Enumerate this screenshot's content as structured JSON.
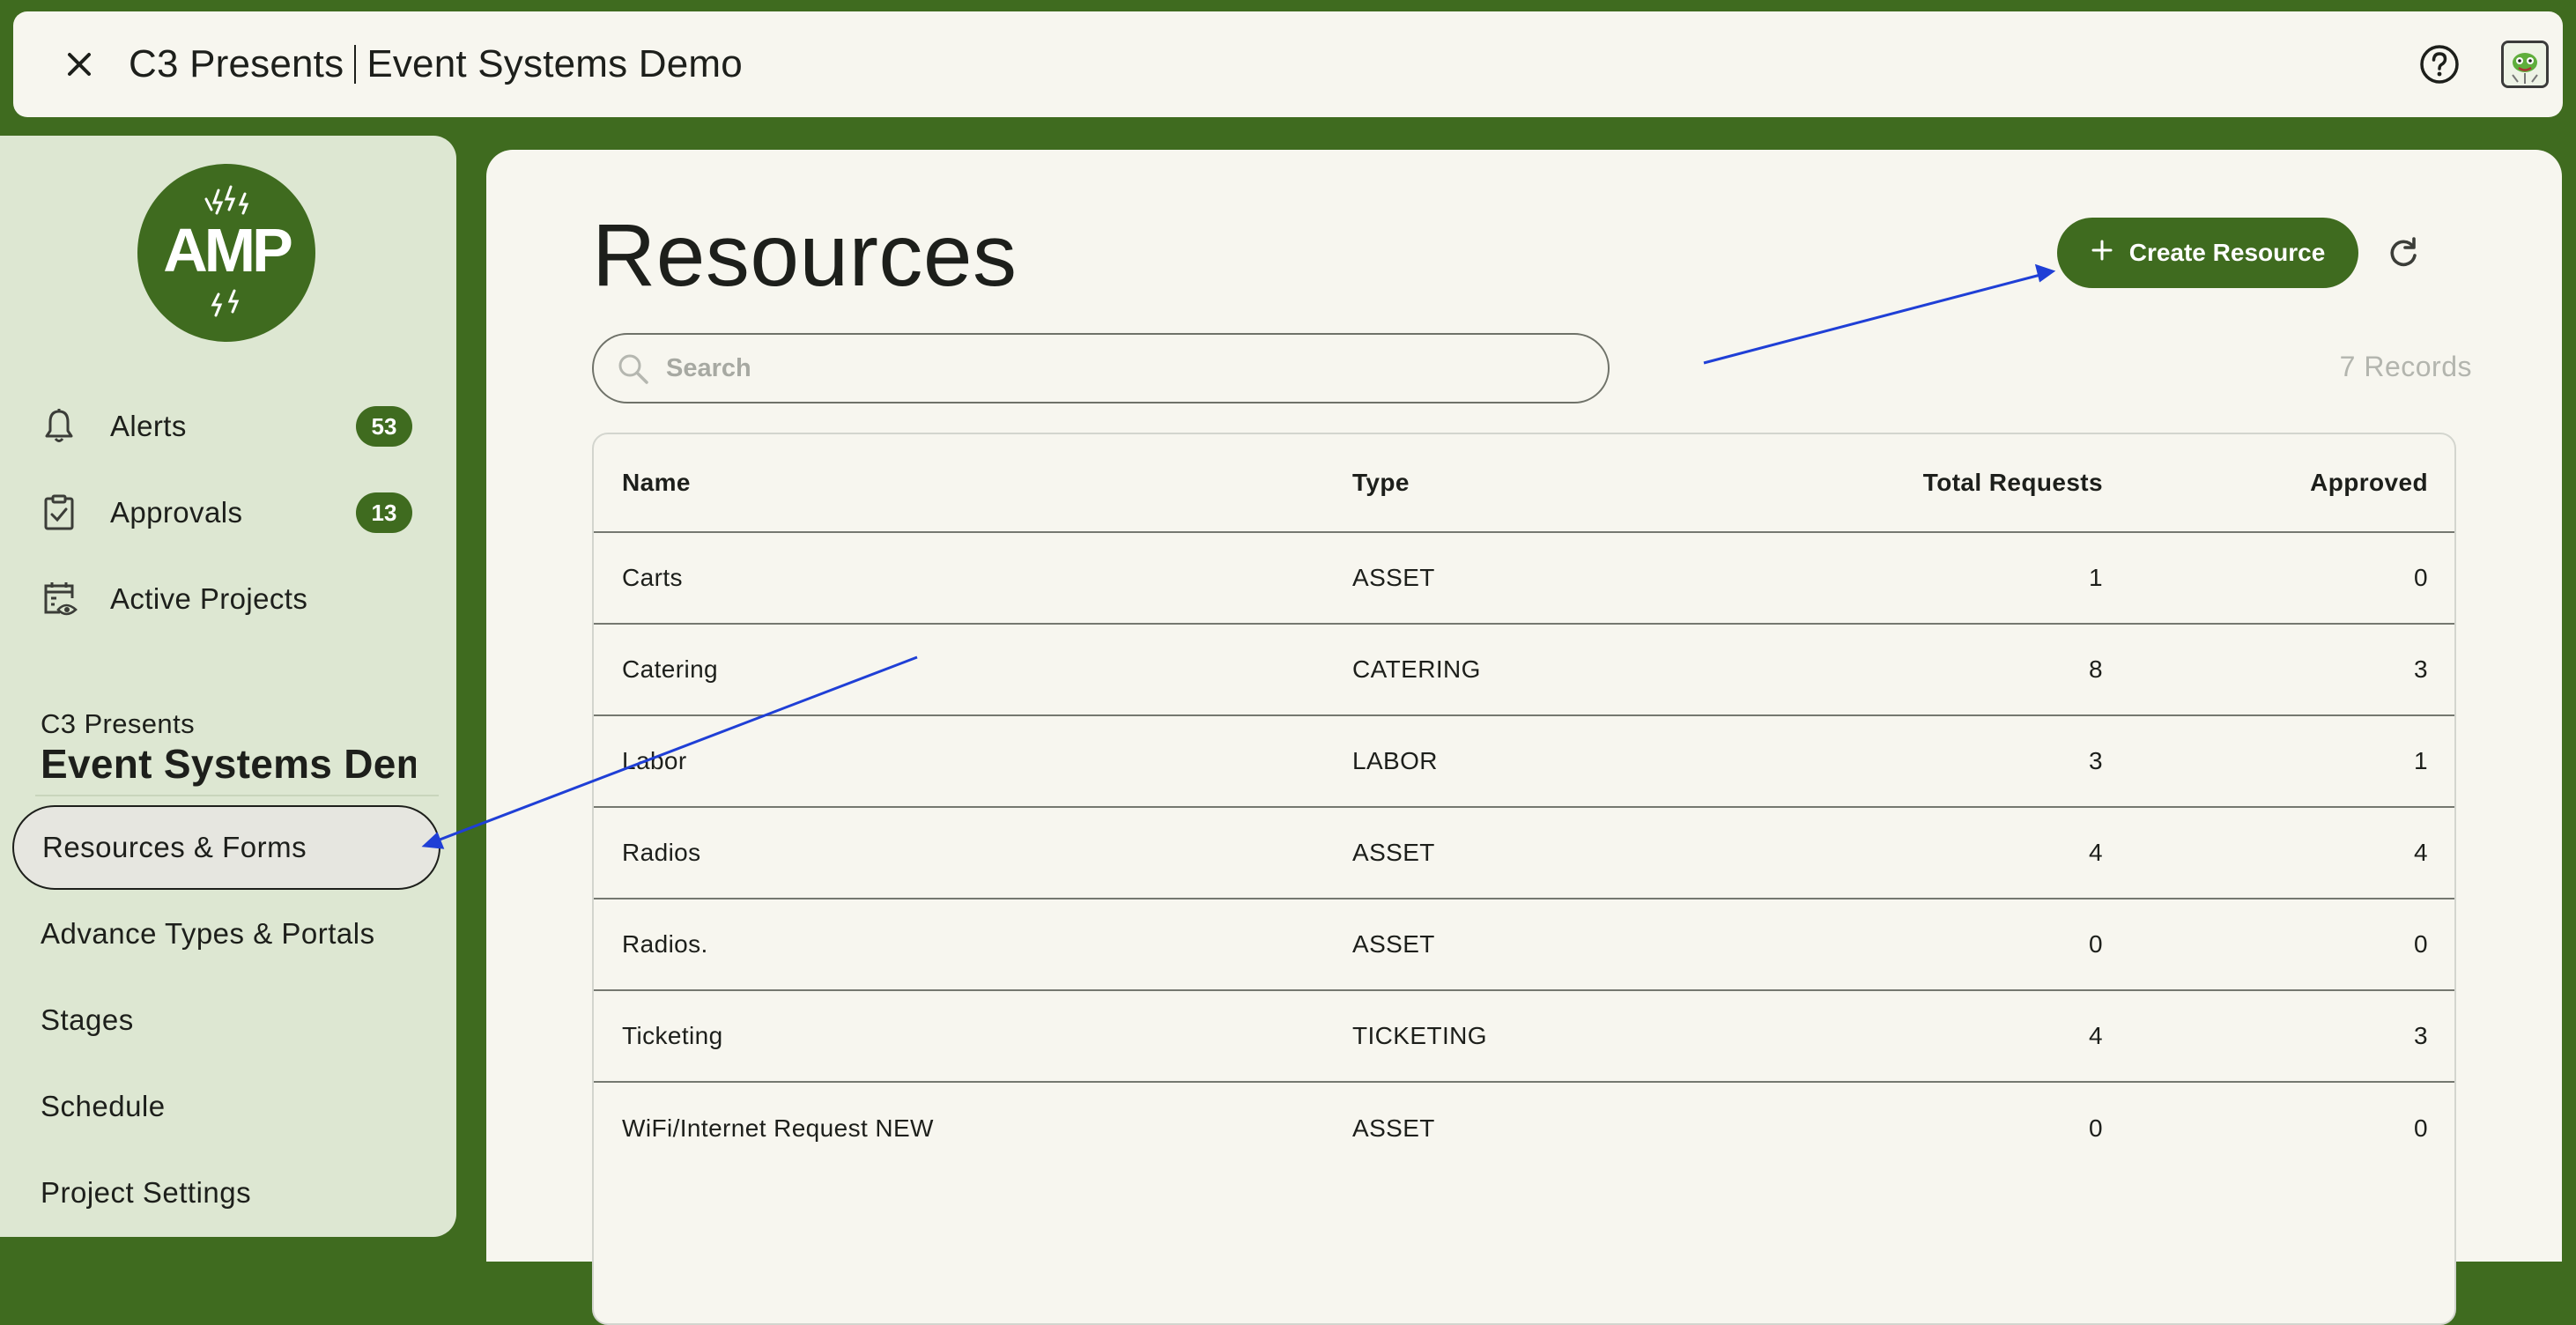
{
  "topbar": {
    "org": "C3 Presents",
    "project": "Event Systems Demo",
    "close_icon": "close-icon",
    "help_icon": "help-circle-icon",
    "avatar_icon": "user-avatar-icon"
  },
  "sidebar": {
    "logo_text": "AMP",
    "nav": [
      {
        "label": "Alerts",
        "icon": "bell-icon",
        "badge": "53"
      },
      {
        "label": "Approvals",
        "icon": "clipboard-check-icon",
        "badge": "13"
      },
      {
        "label": "Active Projects",
        "icon": "calendar-eye-icon"
      }
    ],
    "org_name": "C3 Presents",
    "project_name": "Event Systems Demo",
    "menu": [
      {
        "label": "Resources & Forms",
        "active": true
      },
      {
        "label": "Advance Types & Portals"
      },
      {
        "label": "Stages"
      },
      {
        "label": "Schedule"
      },
      {
        "label": "Project Settings"
      }
    ]
  },
  "main": {
    "title": "Resources",
    "create_label": "Create Resource",
    "search_placeholder": "Search",
    "records": "7 Records",
    "table": {
      "columns": [
        "Name",
        "Type",
        "Total Requests",
        "Approved"
      ],
      "rows": [
        [
          "Carts",
          "ASSET",
          "1",
          "0"
        ],
        [
          "Catering",
          "CATERING",
          "8",
          "3"
        ],
        [
          "Labor",
          "LABOR",
          "3",
          "1"
        ],
        [
          "Radios",
          "ASSET",
          "4",
          "4"
        ],
        [
          "Radios.",
          "ASSET",
          "0",
          "0"
        ],
        [
          "Ticketing",
          "TICKETING",
          "4",
          "3"
        ],
        [
          "WiFi/Internet Request NEW",
          "ASSET",
          "0",
          "0"
        ]
      ]
    }
  },
  "colors": {
    "brand_green": "#3f6b1f",
    "sidebar_bg": "#dde7d2",
    "panel_bg": "#f7f6ef",
    "annotation_blue": "#1f3fd6"
  }
}
